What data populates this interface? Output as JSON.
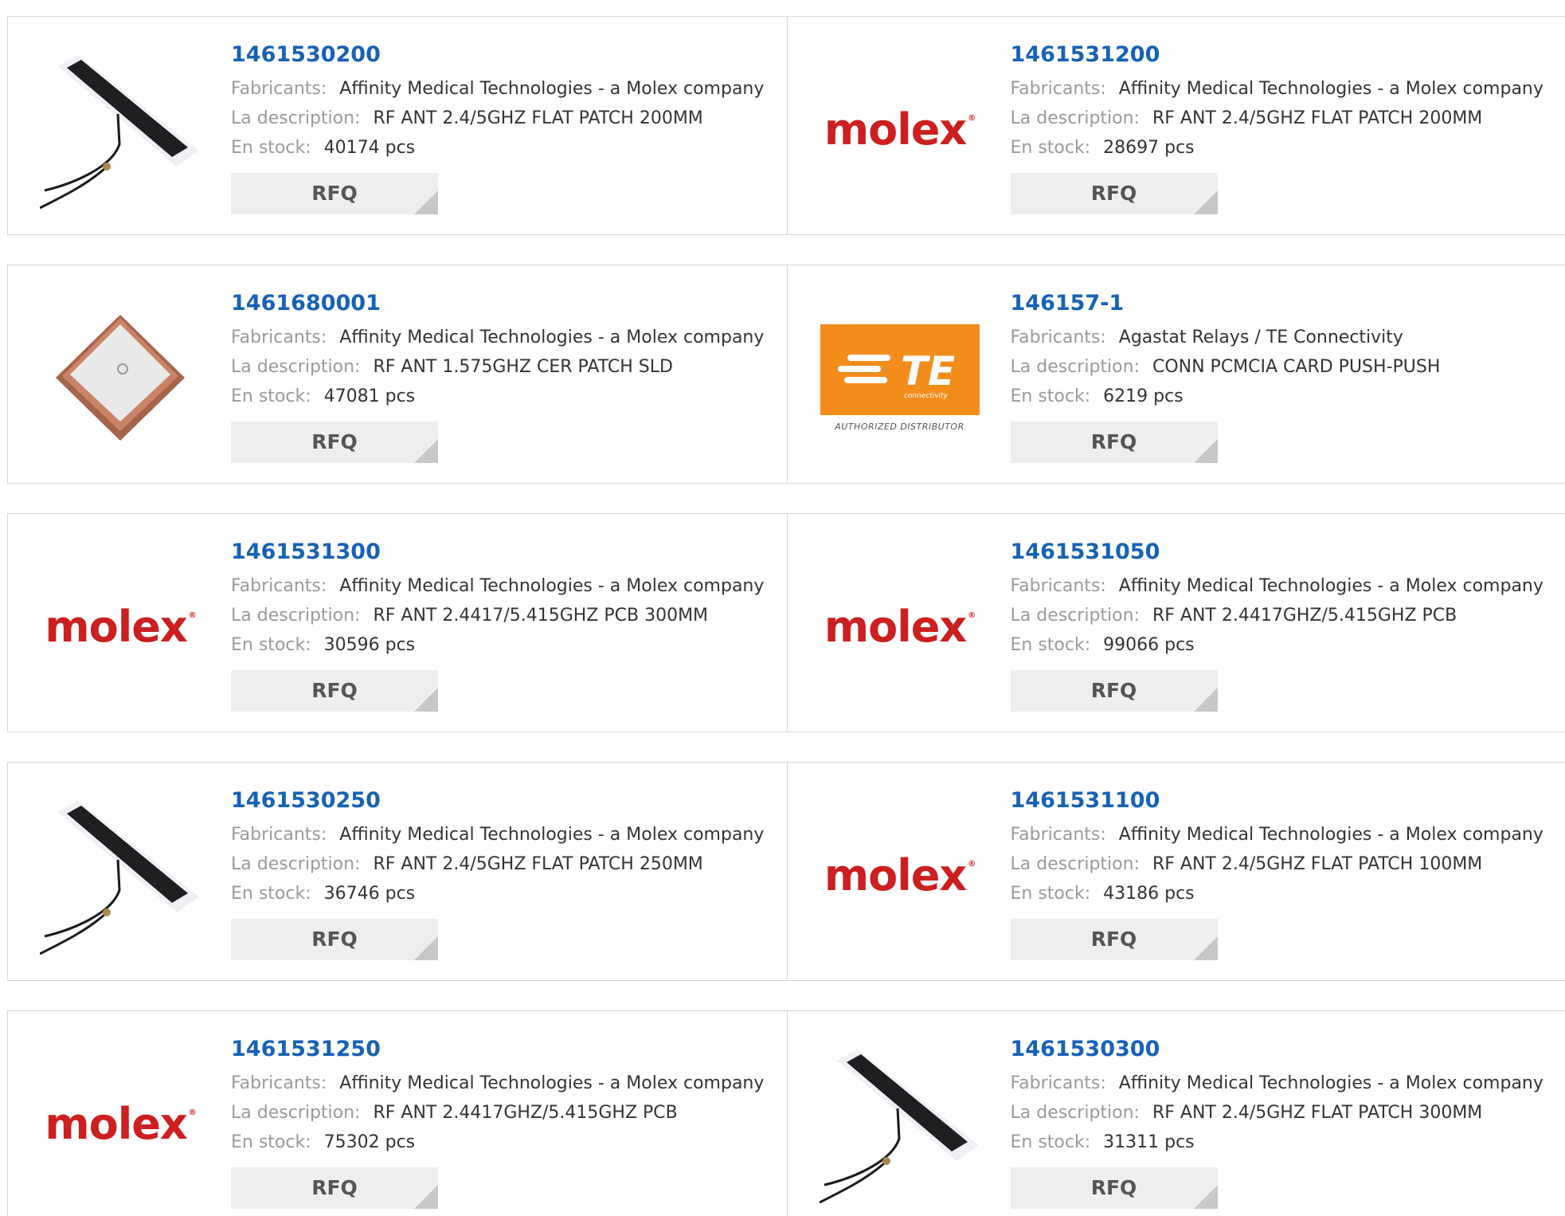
{
  "labels": {
    "manufacturer": "Fabricants:",
    "description": "La description:",
    "stock": "En stock:",
    "rfq": "RFQ"
  },
  "brand_colors": {
    "part_link": "#1662b5",
    "molex_red": "#cc1f1f",
    "te_orange": "#f28c1b"
  },
  "products": [
    {
      "part": "1461530200",
      "manufacturer": "Affinity Medical Technologies - a Molex company",
      "description": "RF ANT 2.4/5GHZ FLAT PATCH 200MM",
      "stock": "40174 pcs",
      "image": "flat-patch-antenna-image"
    },
    {
      "part": "1461531200",
      "manufacturer": "Affinity Medical Technologies - a Molex company",
      "description": "RF ANT 2.4/5GHZ FLAT PATCH 200MM",
      "stock": "28697 pcs",
      "image": "molex-logo",
      "logo_text": "molex"
    },
    {
      "part": "1461680001",
      "manufacturer": "Affinity Medical Technologies - a Molex company",
      "description": "RF ANT 1.575GHZ CER PATCH SLD",
      "stock": "47081 pcs",
      "image": "ceramic-patch-antenna-image"
    },
    {
      "part": "146157-1",
      "manufacturer": "Agastat Relays / TE Connectivity",
      "description": "CONN PCMCIA CARD PUSH-PUSH",
      "stock": "6219 pcs",
      "image": "te-connectivity-logo",
      "logo_text": "TE",
      "logo_subtext": "connectivity",
      "logo_caption": "AUTHORIZED DISTRIBUTOR"
    },
    {
      "part": "1461531300",
      "manufacturer": "Affinity Medical Technologies - a Molex company",
      "description": "RF ANT 2.4417/5.415GHZ PCB 300MM",
      "stock": "30596 pcs",
      "image": "molex-logo",
      "logo_text": "molex"
    },
    {
      "part": "1461531050",
      "manufacturer": "Affinity Medical Technologies - a Molex company",
      "description": "RF ANT 2.4417GHZ/5.415GHZ PCB",
      "stock": "99066 pcs",
      "image": "molex-logo",
      "logo_text": "molex"
    },
    {
      "part": "1461530250",
      "manufacturer": "Affinity Medical Technologies - a Molex company",
      "description": "RF ANT 2.4/5GHZ FLAT PATCH 250MM",
      "stock": "36746 pcs",
      "image": "flat-patch-antenna-image"
    },
    {
      "part": "1461531100",
      "manufacturer": "Affinity Medical Technologies - a Molex company",
      "description": "RF ANT 2.4/5GHZ FLAT PATCH 100MM",
      "stock": "43186 pcs",
      "image": "molex-logo",
      "logo_text": "molex"
    },
    {
      "part": "1461531250",
      "manufacturer": "Affinity Medical Technologies - a Molex company",
      "description": "RF ANT 2.4417GHZ/5.415GHZ PCB",
      "stock": "75302 pcs",
      "image": "molex-logo",
      "logo_text": "molex"
    },
    {
      "part": "1461530300",
      "manufacturer": "Affinity Medical Technologies - a Molex company",
      "description": "RF ANT 2.4/5GHZ FLAT PATCH 300MM",
      "stock": "31311 pcs",
      "image": "flat-patch-antenna-image"
    }
  ]
}
